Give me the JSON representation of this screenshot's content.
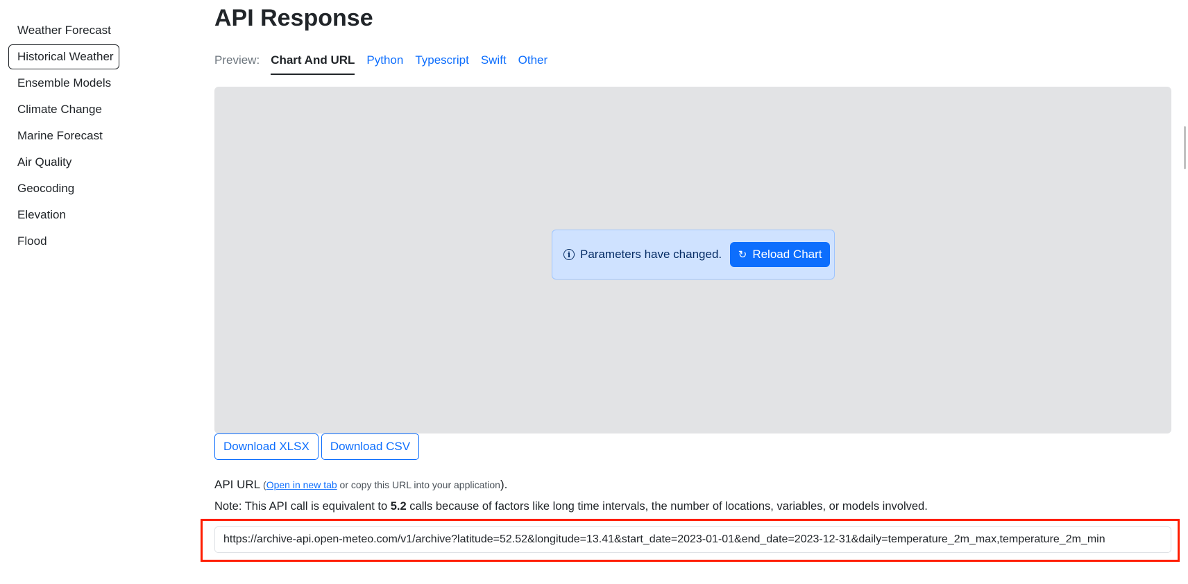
{
  "sidebar": {
    "items": [
      {
        "label": "Weather Forecast"
      },
      {
        "label": "Historical Weather"
      },
      {
        "label": "Ensemble Models"
      },
      {
        "label": "Climate Change"
      },
      {
        "label": "Marine Forecast"
      },
      {
        "label": "Air Quality"
      },
      {
        "label": "Geocoding"
      },
      {
        "label": "Elevation"
      },
      {
        "label": "Flood"
      }
    ],
    "active_label": "Historical Weather"
  },
  "main": {
    "title": "API Response",
    "preview_label": "Preview:",
    "tabs": [
      {
        "label": "Chart And URL"
      },
      {
        "label": "Python"
      },
      {
        "label": "Typescript"
      },
      {
        "label": "Swift"
      },
      {
        "label": "Other"
      }
    ],
    "active_tab": "Chart And URL",
    "notice": {
      "text": "Parameters have changed.",
      "button_label": "Reload Chart"
    },
    "downloads": {
      "xlsx_label": "Download XLSX",
      "csv_label": "Download CSV"
    },
    "api_url": {
      "label": "API URL",
      "open_paren": " (",
      "link_text": "Open in new tab",
      "suffix_text": " or copy this URL into your application",
      "close_paren": ").",
      "value": "https://archive-api.open-meteo.com/v1/archive?latitude=52.52&longitude=13.41&start_date=2023-01-01&end_date=2023-12-31&daily=temperature_2m_max,temperature_2m_min"
    },
    "note": {
      "prefix": "Note: This API call is equivalent to ",
      "calls": "5.2",
      "suffix": " calls because of factors like long time intervals, the number of locations, variables, or models involved."
    }
  },
  "colors": {
    "accent": "#0d6efd",
    "chart_bg": "#e2e3e5",
    "notice_bg": "#cfe2ff",
    "highlight": "#ff1d00"
  }
}
